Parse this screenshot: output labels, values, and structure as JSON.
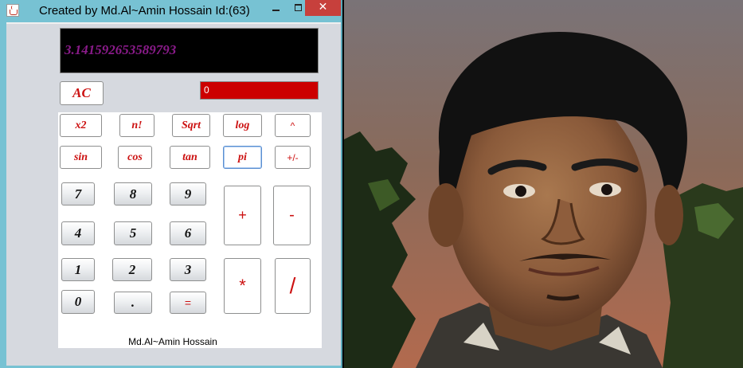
{
  "window": {
    "title": "Created by Md.Al~Amin Hossain Id:(63)",
    "close_glyph": "✕"
  },
  "display": {
    "value": "3.141592653589793"
  },
  "memory_field": {
    "value": "0"
  },
  "buttons": {
    "ac": "AC",
    "x2": "x2",
    "fact": "n!",
    "sqrt": "Sqrt",
    "log": "log",
    "pow": "^",
    "sin": "sin",
    "cos": "cos",
    "tan": "tan",
    "pi": "pi",
    "sign": "+/-",
    "d7": "7",
    "d8": "8",
    "d9": "9",
    "d4": "4",
    "d5": "5",
    "d6": "6",
    "d1": "1",
    "d2": "2",
    "d3": "3",
    "d0": "0",
    "dot": ".",
    "eq": "=",
    "plus": "+",
    "minus": "-",
    "mul": "*",
    "div": "/"
  },
  "footer": {
    "text": "Md.Al~Amin Hossain"
  },
  "colors": {
    "accent_red": "#cc0000",
    "display_text": "#8a1b8a",
    "window_frame": "#77c2d3"
  }
}
